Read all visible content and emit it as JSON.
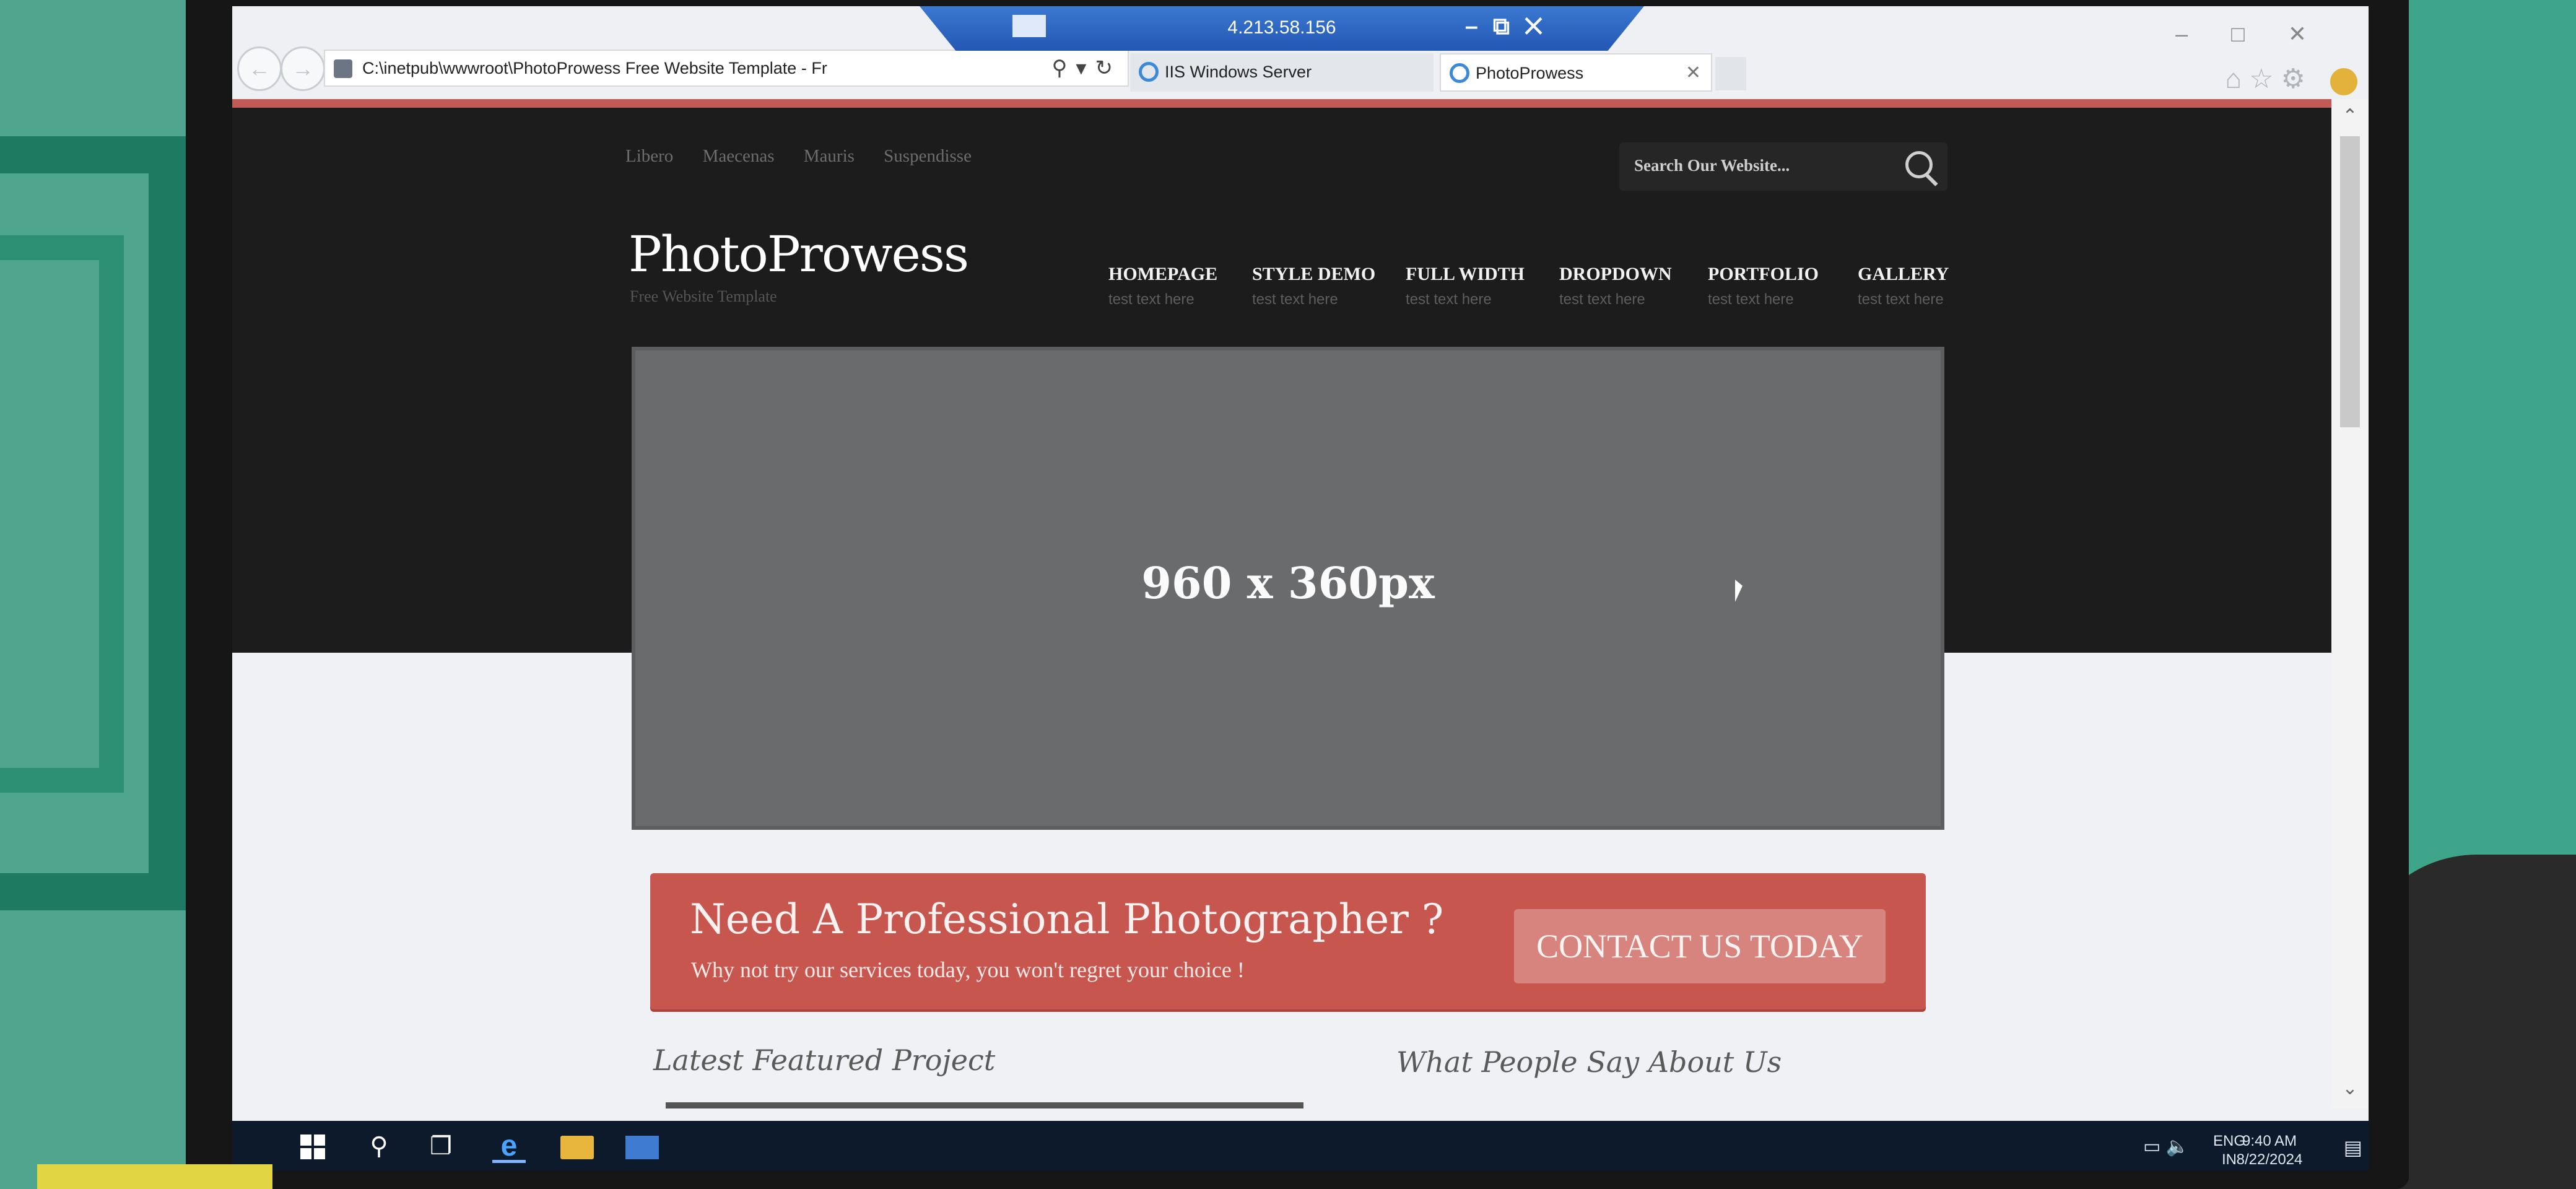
{
  "rdp": {
    "host": "4.213.58.156"
  },
  "browser": {
    "address": "C:\\inetpub\\wwwroot\\PhotoProwess Free Website Template - Fr",
    "tabs": [
      {
        "label": "IIS Windows Server"
      },
      {
        "label": "PhotoProwess"
      }
    ]
  },
  "site": {
    "top_links": [
      "Libero",
      "Maecenas",
      "Mauris",
      "Suspendisse"
    ],
    "search_placeholder": "Search Our Website...",
    "logo": "PhotoProwess",
    "tagline": "Free Website Template",
    "nav": [
      {
        "label": "HOMEPAGE",
        "sub": "test text here"
      },
      {
        "label": "STYLE DEMO",
        "sub": "test text here"
      },
      {
        "label": "FULL WIDTH",
        "sub": "test text here"
      },
      {
        "label": "DROPDOWN",
        "sub": "test text here"
      },
      {
        "label": "PORTFOLIO",
        "sub": "test text here"
      },
      {
        "label": "GALLERY",
        "sub": "test text here"
      }
    ],
    "slider_text": "960 x 360px",
    "cta": {
      "title": "Need A Professional Photographer ?",
      "subtitle": "Why not try our services today, you won't regret your choice !",
      "button": "CONTACT US TODAY"
    },
    "sections": {
      "left": "Latest Featured Project",
      "right": "What People Say About Us"
    }
  },
  "taskbar": {
    "language": "ENG",
    "region": "IN",
    "time": "9:40 AM",
    "date": "8/22/2024"
  },
  "colors": {
    "accent_red": "#c7564f",
    "header_dark": "#1c1c1c",
    "taskbar": "#0d1a2c"
  }
}
